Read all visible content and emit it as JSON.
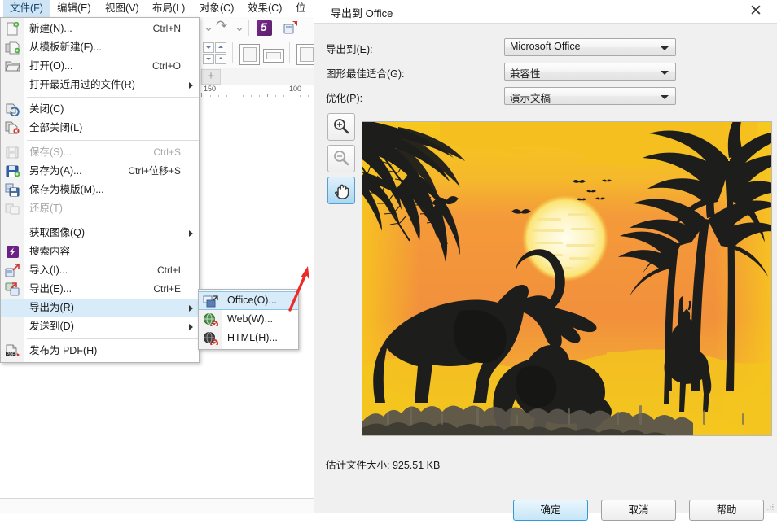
{
  "menubar": {
    "items": [
      {
        "label": "文件(F)",
        "active": true
      },
      {
        "label": "编辑(E)",
        "active": false
      },
      {
        "label": "视图(V)",
        "active": false
      },
      {
        "label": "布局(L)",
        "active": false
      },
      {
        "label": "对象(C)",
        "active": false
      },
      {
        "label": "效果(C)",
        "active": false
      },
      {
        "label": "位",
        "active": false
      }
    ]
  },
  "ruler": {
    "labels": [
      "150",
      "100"
    ]
  },
  "file_menu": {
    "items": [
      {
        "type": "item",
        "label": "新建(N)...",
        "shortcut": "Ctrl+N",
        "icon": "new-document-icon",
        "disabled": false,
        "submenu": false
      },
      {
        "type": "item",
        "label": "从模板新建(F)...",
        "shortcut": "",
        "icon": "new-from-template-icon",
        "disabled": false,
        "submenu": false
      },
      {
        "type": "item",
        "label": "打开(O)...",
        "shortcut": "Ctrl+O",
        "icon": "open-folder-icon",
        "disabled": false,
        "submenu": false
      },
      {
        "type": "item",
        "label": "打开最近用过的文件(R)",
        "shortcut": "",
        "icon": "",
        "disabled": false,
        "submenu": true
      },
      {
        "type": "sep"
      },
      {
        "type": "item",
        "label": "关闭(C)",
        "shortcut": "",
        "icon": "close-document-icon",
        "disabled": false,
        "submenu": false
      },
      {
        "type": "item",
        "label": "全部关闭(L)",
        "shortcut": "",
        "icon": "close-all-icon",
        "disabled": false,
        "submenu": false
      },
      {
        "type": "sep"
      },
      {
        "type": "item",
        "label": "保存(S)...",
        "shortcut": "Ctrl+S",
        "icon": "save-icon",
        "disabled": true,
        "submenu": false
      },
      {
        "type": "item",
        "label": "另存为(A)...",
        "shortcut": "Ctrl+位移+S",
        "icon": "save-as-icon",
        "disabled": false,
        "submenu": false
      },
      {
        "type": "item",
        "label": "保存为模版(M)...",
        "shortcut": "",
        "icon": "save-template-icon",
        "disabled": false,
        "submenu": false
      },
      {
        "type": "item",
        "label": "还原(T)",
        "shortcut": "",
        "icon": "revert-icon",
        "disabled": true,
        "submenu": false
      },
      {
        "type": "sep"
      },
      {
        "type": "item",
        "label": "获取图像(Q)",
        "shortcut": "",
        "icon": "",
        "disabled": false,
        "submenu": true
      },
      {
        "type": "item",
        "label": "搜索内容",
        "shortcut": "",
        "icon": "connect-icon",
        "disabled": false,
        "submenu": false
      },
      {
        "type": "item",
        "label": "导入(I)...",
        "shortcut": "Ctrl+I",
        "icon": "import-icon",
        "disabled": false,
        "submenu": false
      },
      {
        "type": "item",
        "label": "导出(E)...",
        "shortcut": "Ctrl+E",
        "icon": "export-icon",
        "disabled": false,
        "submenu": false
      },
      {
        "type": "item",
        "label": "导出为(R)",
        "shortcut": "",
        "icon": "",
        "disabled": false,
        "submenu": true,
        "highlighted": true
      },
      {
        "type": "item",
        "label": "发送到(D)",
        "shortcut": "",
        "icon": "",
        "disabled": false,
        "submenu": true
      },
      {
        "type": "sep"
      },
      {
        "type": "item",
        "label": "发布为 PDF(H)",
        "shortcut": "",
        "icon": "pdf-icon",
        "disabled": false,
        "submenu": false
      }
    ]
  },
  "export_submenu": {
    "items": [
      {
        "label": "Office(O)...",
        "icon": "office-icon",
        "highlighted": true
      },
      {
        "label": "Web(W)...",
        "icon": "web-icon",
        "highlighted": false
      },
      {
        "label": "HTML(H)...",
        "icon": "html-icon",
        "highlighted": false
      }
    ]
  },
  "dialog": {
    "title": "导出到 Office",
    "close_label": "✕",
    "fields": [
      {
        "label": "导出到(E):",
        "value": "Microsoft Office"
      },
      {
        "label": "图形最佳适合(G):",
        "value": "兼容性"
      },
      {
        "label": "优化(P):",
        "value": "演示文稿"
      }
    ],
    "zoom_tools": [
      {
        "name": "zoom-in-tool",
        "selected": false,
        "disabled": false
      },
      {
        "name": "zoom-out-tool",
        "selected": false,
        "disabled": true
      },
      {
        "name": "pan-tool",
        "selected": true,
        "disabled": false
      }
    ],
    "preview_alt": "非洲日落剪影 — 大象、长颈鹿、棕榈树",
    "file_size": "估计文件大小: 925.51 KB",
    "buttons": [
      {
        "label": "确定",
        "primary": true
      },
      {
        "label": "取消",
        "primary": false
      },
      {
        "label": "帮助",
        "primary": false
      }
    ]
  },
  "colors": {
    "accent": "#2f9ad6",
    "menu_highlight": "#d7ebf9",
    "annotation_arrow": "#ec2b28",
    "sky_yellow": "#f5c620",
    "sky_orange": "#f2903c",
    "silhouette": "#1d1d1b",
    "sun": "#fff6c8"
  }
}
